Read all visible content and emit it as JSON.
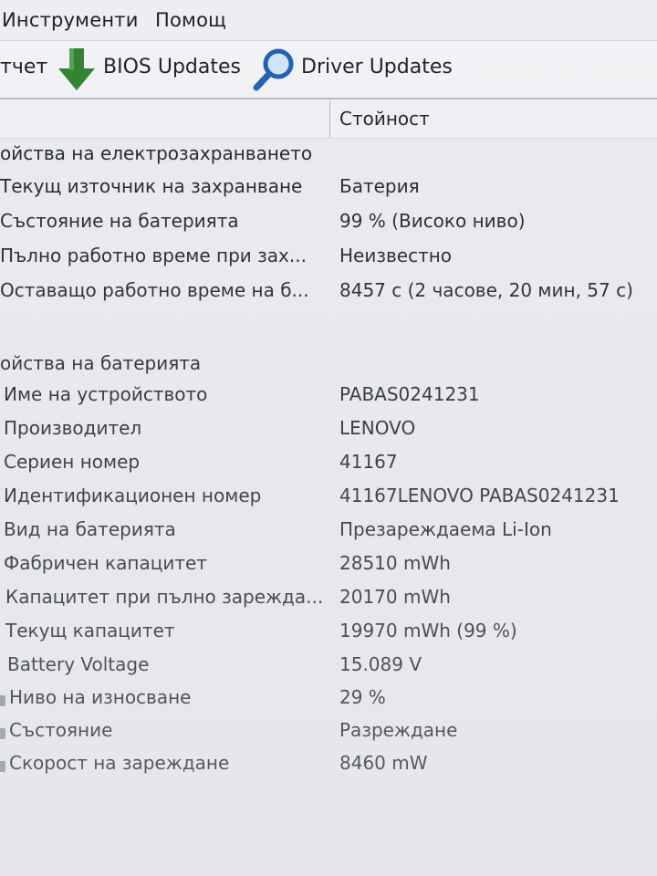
{
  "menu": {
    "tools": "Инструменти",
    "help": "Помощ"
  },
  "toolbar": {
    "report_label": "тчет",
    "bios_label": "BIOS Updates",
    "driver_label": "Driver Updates",
    "icons": [
      "download-arrow-icon",
      "magnifier-icon"
    ],
    "colors": {
      "arrow": "#2f7f2d",
      "magnifier": "#1f5fae"
    }
  },
  "columns": {
    "value": "Стойност"
  },
  "sections": {
    "power": {
      "title": "ойства на електрозахранването",
      "rows": [
        {
          "field": "Текущ източник на захранване",
          "value": "Батерия"
        },
        {
          "field": "Състояние на батерията",
          "value": "99 % (Високо ниво)"
        },
        {
          "field": "Пълно работно време при зах...",
          "value": "Неизвестно"
        },
        {
          "field": "Оставащо работно време на б...",
          "value": "8457 с (2 часове, 20 мин, 57 с)"
        }
      ]
    },
    "battery": {
      "title": "ойства на батерията",
      "rows": [
        {
          "field": "Име на устройството",
          "value": "PABAS0241231"
        },
        {
          "field": "Производител",
          "value": "LENOVO"
        },
        {
          "field": "Сериен номер",
          "value": "41167"
        },
        {
          "field": "Идентификационен номер",
          "value": "41167LENOVO PABAS0241231"
        },
        {
          "field": "Вид на батерията",
          "value": "Презареждаема Li-Ion"
        },
        {
          "field": "Фабричен капацитет",
          "value": "28510 mWh"
        },
        {
          "field": "Капацитет при пълно зарежда...",
          "value": "20170 mWh"
        },
        {
          "field": "Текущ капацитет",
          "value": "19970 mWh  (99 %)"
        },
        {
          "field": "Battery Voltage",
          "value": "15.089 V"
        },
        {
          "field": "Ниво на износване",
          "value": "29 %"
        },
        {
          "field": "Състояние",
          "value": "Разреждане"
        },
        {
          "field": "Скорост на зареждане",
          "value": "8460 mW"
        }
      ]
    }
  }
}
